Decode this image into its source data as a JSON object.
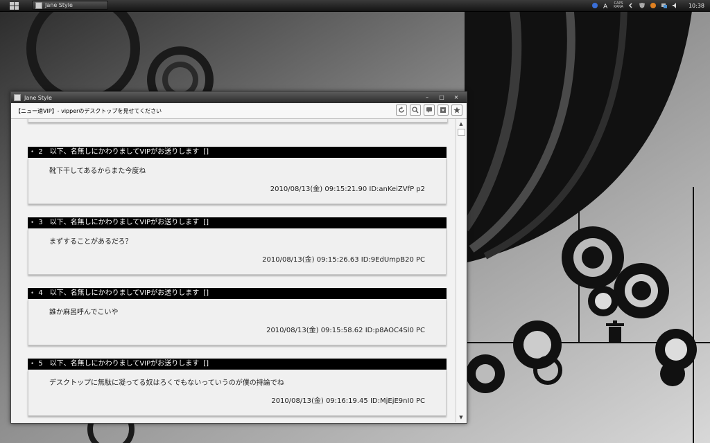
{
  "taskbar": {
    "task_label": "Jane Style",
    "caps_top": "CAPS",
    "caps_bottom": "KANA",
    "clock": "10:38"
  },
  "window": {
    "title": "Jane Style",
    "thread_title": "【ニュー速VIP】- vipperのデスクトップを見せてください",
    "controls": [
      "–",
      "□",
      "×"
    ]
  },
  "posts": [
    {
      "number": "2",
      "name": "以下、名無しにかわりましてVIPがお送りします",
      "mail": "[]",
      "message": "靴下干してあるからまた今度ね",
      "datetime": "2010/08/13(金) 09:15:21.90",
      "id": "ID:anKeiZVfP p2"
    },
    {
      "number": "3",
      "name": "以下、名無しにかわりましてVIPがお送りします",
      "mail": "[]",
      "message": "まずすることがあるだろ？",
      "datetime": "2010/08/13(金) 09:15:26.63",
      "id": "ID:9EdUmpB20 PC"
    },
    {
      "number": "4",
      "name": "以下、名無しにかわりましてVIPがお送りします",
      "mail": "[]",
      "message": "誰か麻呂呼んでこいや",
      "datetime": "2010/08/13(金) 09:15:58.62",
      "id": "ID:p8AOC4Sl0 PC"
    },
    {
      "number": "5",
      "name": "以下、名無しにかわりましてVIPがお送りします",
      "mail": "[]",
      "message": "デスクトップに無駄に凝ってる奴はろくでもないっていうのが僕の持論でね",
      "datetime": "2010/08/13(金) 09:16:19.45",
      "id": "ID:MjEjE9nI0 PC"
    }
  ],
  "colors": {
    "post_header_bg": "#000000",
    "content_bg": "#f2f2f2",
    "taskbar_bg": "#1c1c1c"
  }
}
